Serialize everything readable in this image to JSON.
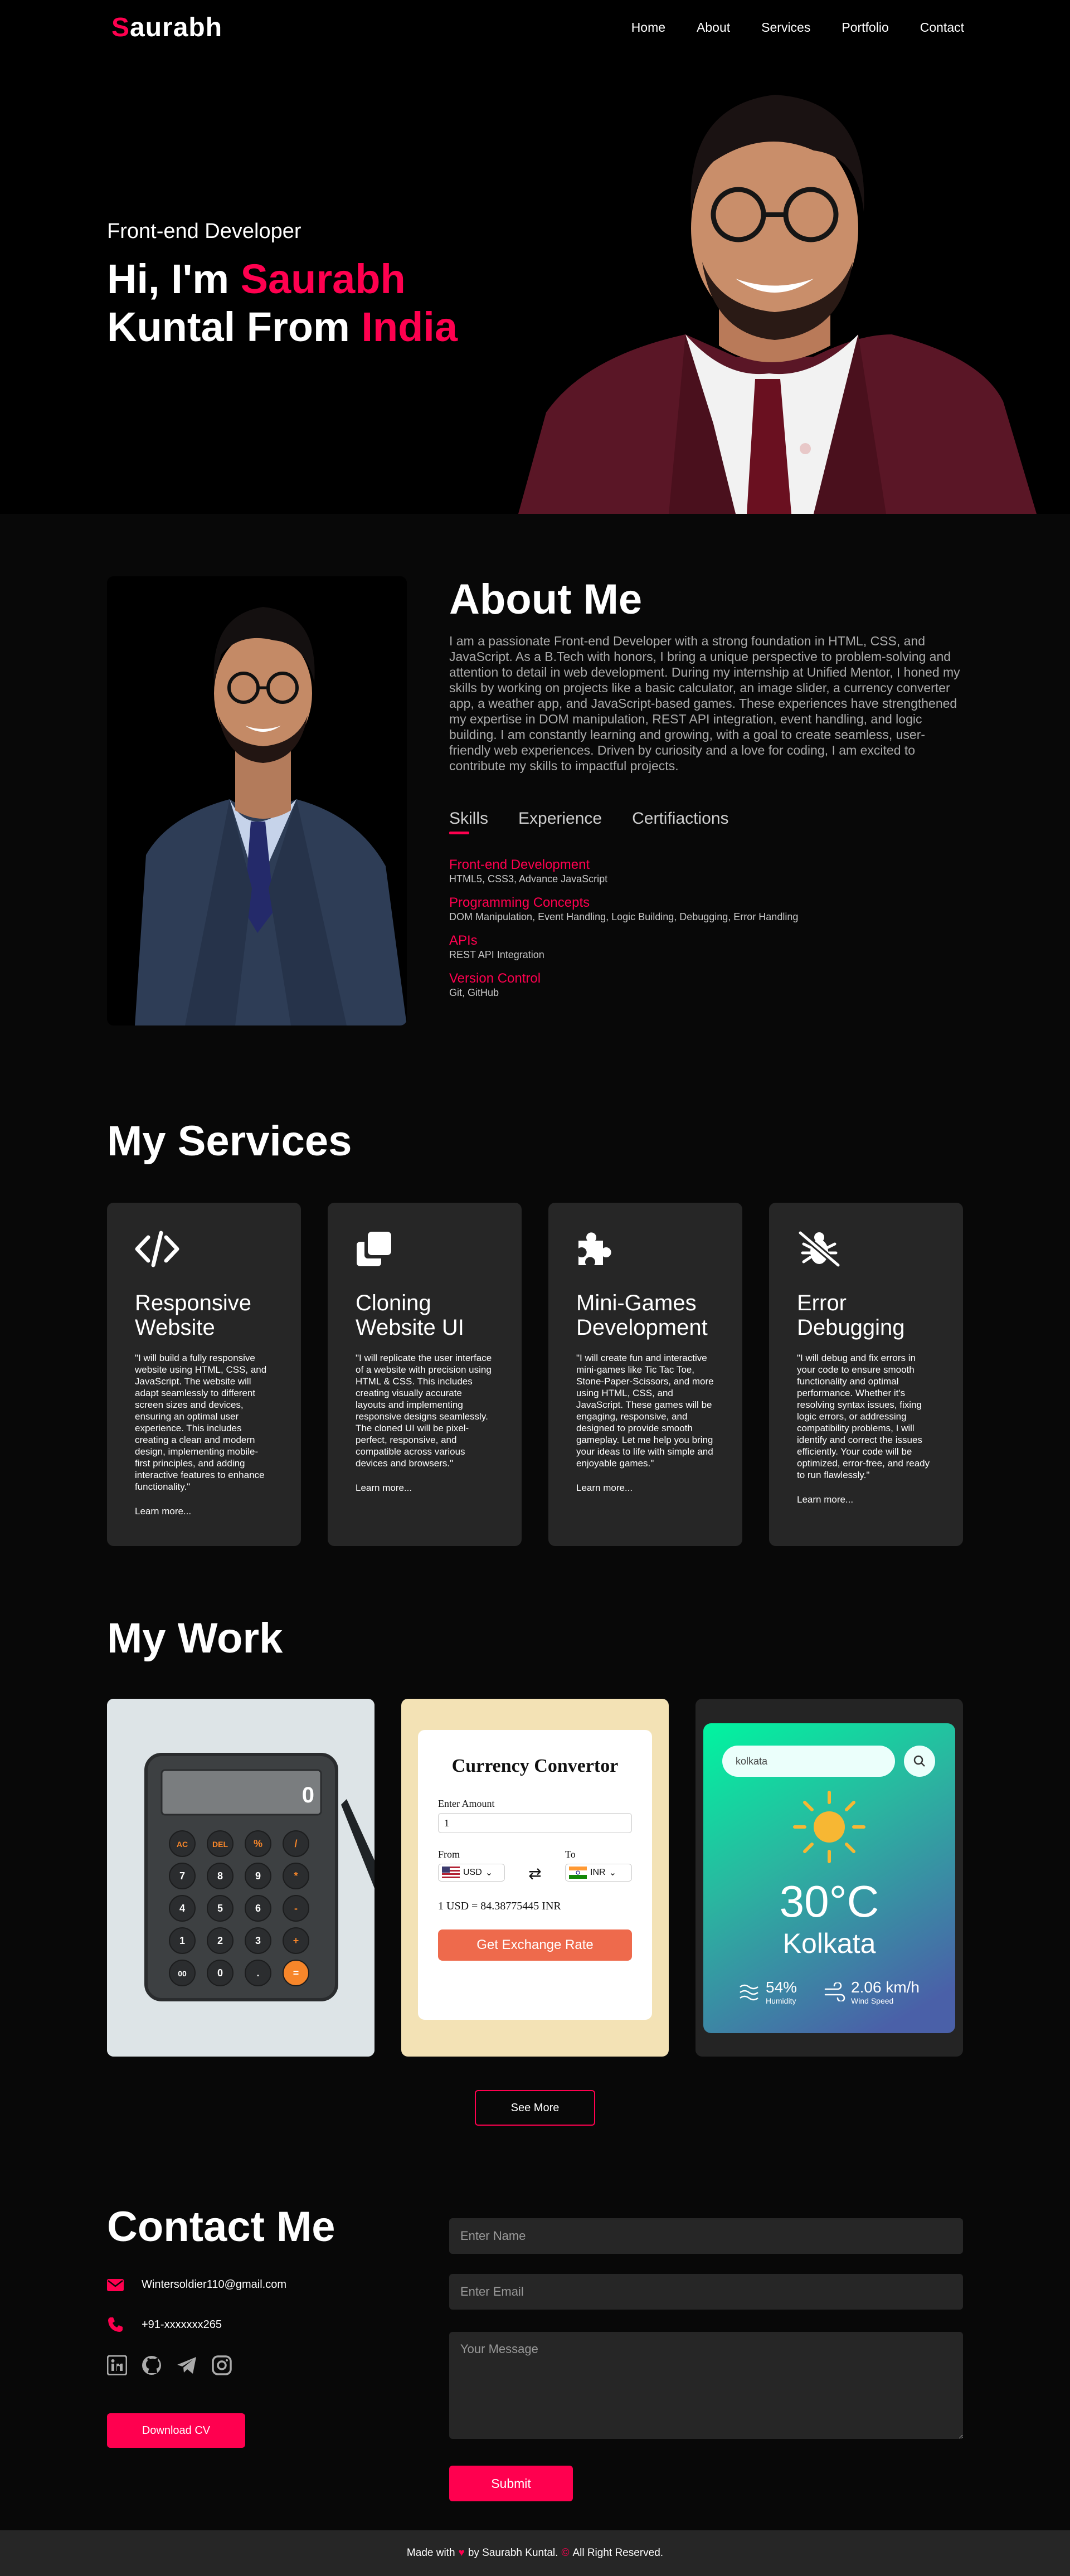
{
  "header": {
    "logo_first": "S",
    "logo_rest": "aurabh",
    "nav": [
      "Home",
      "About",
      "Services",
      "Portfolio",
      "Contact"
    ]
  },
  "hero": {
    "subtitle": "Front-end Developer",
    "line1_prefix": "Hi, I'm ",
    "line1_highlight": "Saurabh",
    "line2_prefix": "Kuntal From ",
    "line2_highlight": "India"
  },
  "about": {
    "title": "About Me",
    "text": "I am a passionate Front-end Developer with a strong foundation in HTML, CSS, and JavaScript. As a B.Tech with honors, I bring a unique perspective to problem-solving and attention to detail in web development. During my internship at Unified Mentor, I honed my skills by working on projects like a basic calculator, an image slider, a currency converter app, a weather app, and JavaScript-based games. These experiences have strengthened my expertise in DOM manipulation, REST API integration, event handling, and logic building. I am constantly learning and growing, with a goal to create seamless, user-friendly web experiences. Driven by curiosity and a love for coding, I am excited to contribute my skills to impactful projects.",
    "tabs": [
      "Skills",
      "Experience",
      "Certifiactions"
    ],
    "skills": [
      {
        "title": "Front-end Development",
        "detail": "HTML5, CSS3, Advance JavaScript"
      },
      {
        "title": "Programming Concepts",
        "detail": "DOM Manipulation, Event Handling, Logic Building, Debugging, Error Handling"
      },
      {
        "title": "APIs",
        "detail": "REST API Integration"
      },
      {
        "title": "Version Control",
        "detail": "Git, GitHub"
      }
    ]
  },
  "services": {
    "title": "My Services",
    "items": [
      {
        "icon": "code-icon",
        "title": "Responsive Website",
        "text": "\"I will build a fully responsive website using HTML, CSS, and JavaScript. The website will adapt seamlessly to different screen sizes and devices, ensuring an optimal user experience. This includes creating a clean and modern design, implementing mobile-first principles, and adding interactive features to enhance functionality.\"",
        "link": "Learn more..."
      },
      {
        "icon": "clone-icon",
        "title": "Cloning Website UI",
        "text": "\"I will replicate the user interface of a website with precision using HTML & CSS. This includes creating visually accurate layouts and implementing responsive designs seamlessly. The cloned UI will be pixel-perfect, responsive, and compatible across various devices and browsers.\"",
        "link": "Learn more..."
      },
      {
        "icon": "puzzle-icon",
        "title": "Mini-Games Development",
        "text": "\"I will create fun and interactive mini-games like Tic Tac Toe, Stone-Paper-Scissors, and more using HTML, CSS, and JavaScript. These games will be engaging, responsive, and designed to provide smooth gameplay. Let me help you bring your ideas to life with simple and enjoyable games.\"",
        "link": "Learn more..."
      },
      {
        "icon": "bug-slash-icon",
        "title": "Error Debugging",
        "text": "\"I will debug and fix errors in your code to ensure smooth functionality and optimal performance. Whether it's resolving syntax issues, fixing logic errors, or addressing compatibility problems, I will identify and correct the issues efficiently. Your code will be optimized, error-free, and ready to run flawlessly.\"",
        "link": "Learn more..."
      }
    ]
  },
  "work": {
    "title": "My Work",
    "calculator": {
      "display": "0",
      "keys": [
        "AC",
        "DEL",
        "%",
        "/",
        "7",
        "8",
        "9",
        "*",
        "4",
        "5",
        "6",
        "-",
        "1",
        "2",
        "3",
        "+",
        "00",
        "0",
        ".",
        "="
      ]
    },
    "currency": {
      "title": "Currency Convertor",
      "amount_label": "Enter Amount",
      "amount_value": "1",
      "from_label": "From",
      "to_label": "To",
      "from": "USD",
      "to": "INR",
      "rate": "1 USD = 84.38775445 INR",
      "button": "Get Exchange Rate"
    },
    "weather": {
      "search_value": "kolkata",
      "temperature": "30°C",
      "city": "Kolkata",
      "humidity_value": "54%",
      "humidity_label": "Humidity",
      "wind_value": "2.06 km/h",
      "wind_label": "Wind Speed"
    },
    "see_more": "See More"
  },
  "contact": {
    "title": "Contact Me",
    "email": "Wintersoldier110@gmail.com",
    "phone": "+91-xxxxxxx265",
    "socials": [
      "linkedin-icon",
      "github-icon",
      "telegram-icon",
      "instagram-icon"
    ],
    "cv_button": "Download CV",
    "name_placeholder": "Enter Name",
    "email_placeholder": "Enter Email",
    "message_placeholder": "Your Message",
    "submit": "Submit"
  },
  "footer": {
    "before": "Made with",
    "after": "by Saurabh Kuntal.",
    "rights": "All Right Reserved."
  },
  "colors": {
    "accent": "#ff004f",
    "card": "#262626",
    "bg": "#080808"
  }
}
